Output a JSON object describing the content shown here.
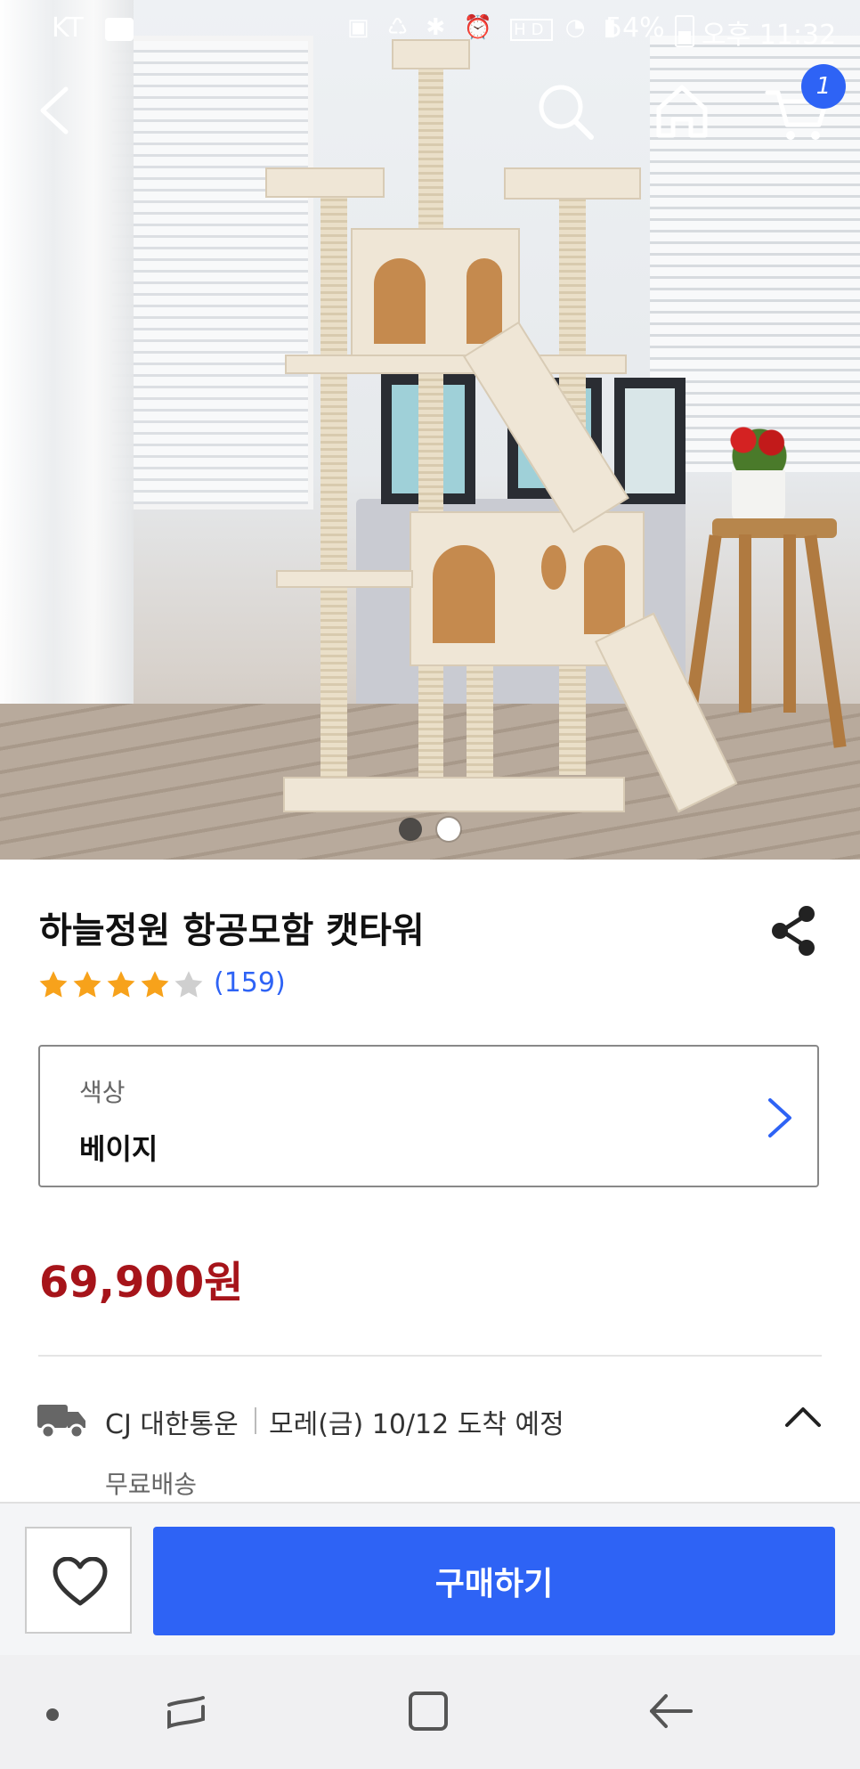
{
  "status_bar": {
    "carrier": "KT",
    "battery_percent": "54%",
    "time": "오후 11:32",
    "icons": [
      "message-icon",
      "battery-saver-icon",
      "recycle-icon",
      "bluetooth-icon",
      "alarm-icon",
      "hd-icon",
      "wifi-icon",
      "signal-icon",
      "battery-icon"
    ]
  },
  "header": {
    "cart_badge_count": "1"
  },
  "gallery": {
    "total_images": 2,
    "current_index": 1
  },
  "product": {
    "title": "하늘정원 항공모함 캣타워",
    "rating": 4,
    "rating_max": 5,
    "review_count": "(159)",
    "option": {
      "label": "색상",
      "value": "베이지"
    },
    "price": "69,900원"
  },
  "shipping": {
    "carrier": "CJ 대한통운",
    "eta": "모레(금) 10/12 도착 예정",
    "fee": "무료배송"
  },
  "actions": {
    "buy_label": "구매하기"
  },
  "colors": {
    "accent": "#2e63f5",
    "price": "#a6141a",
    "star": "#f7a21b"
  }
}
